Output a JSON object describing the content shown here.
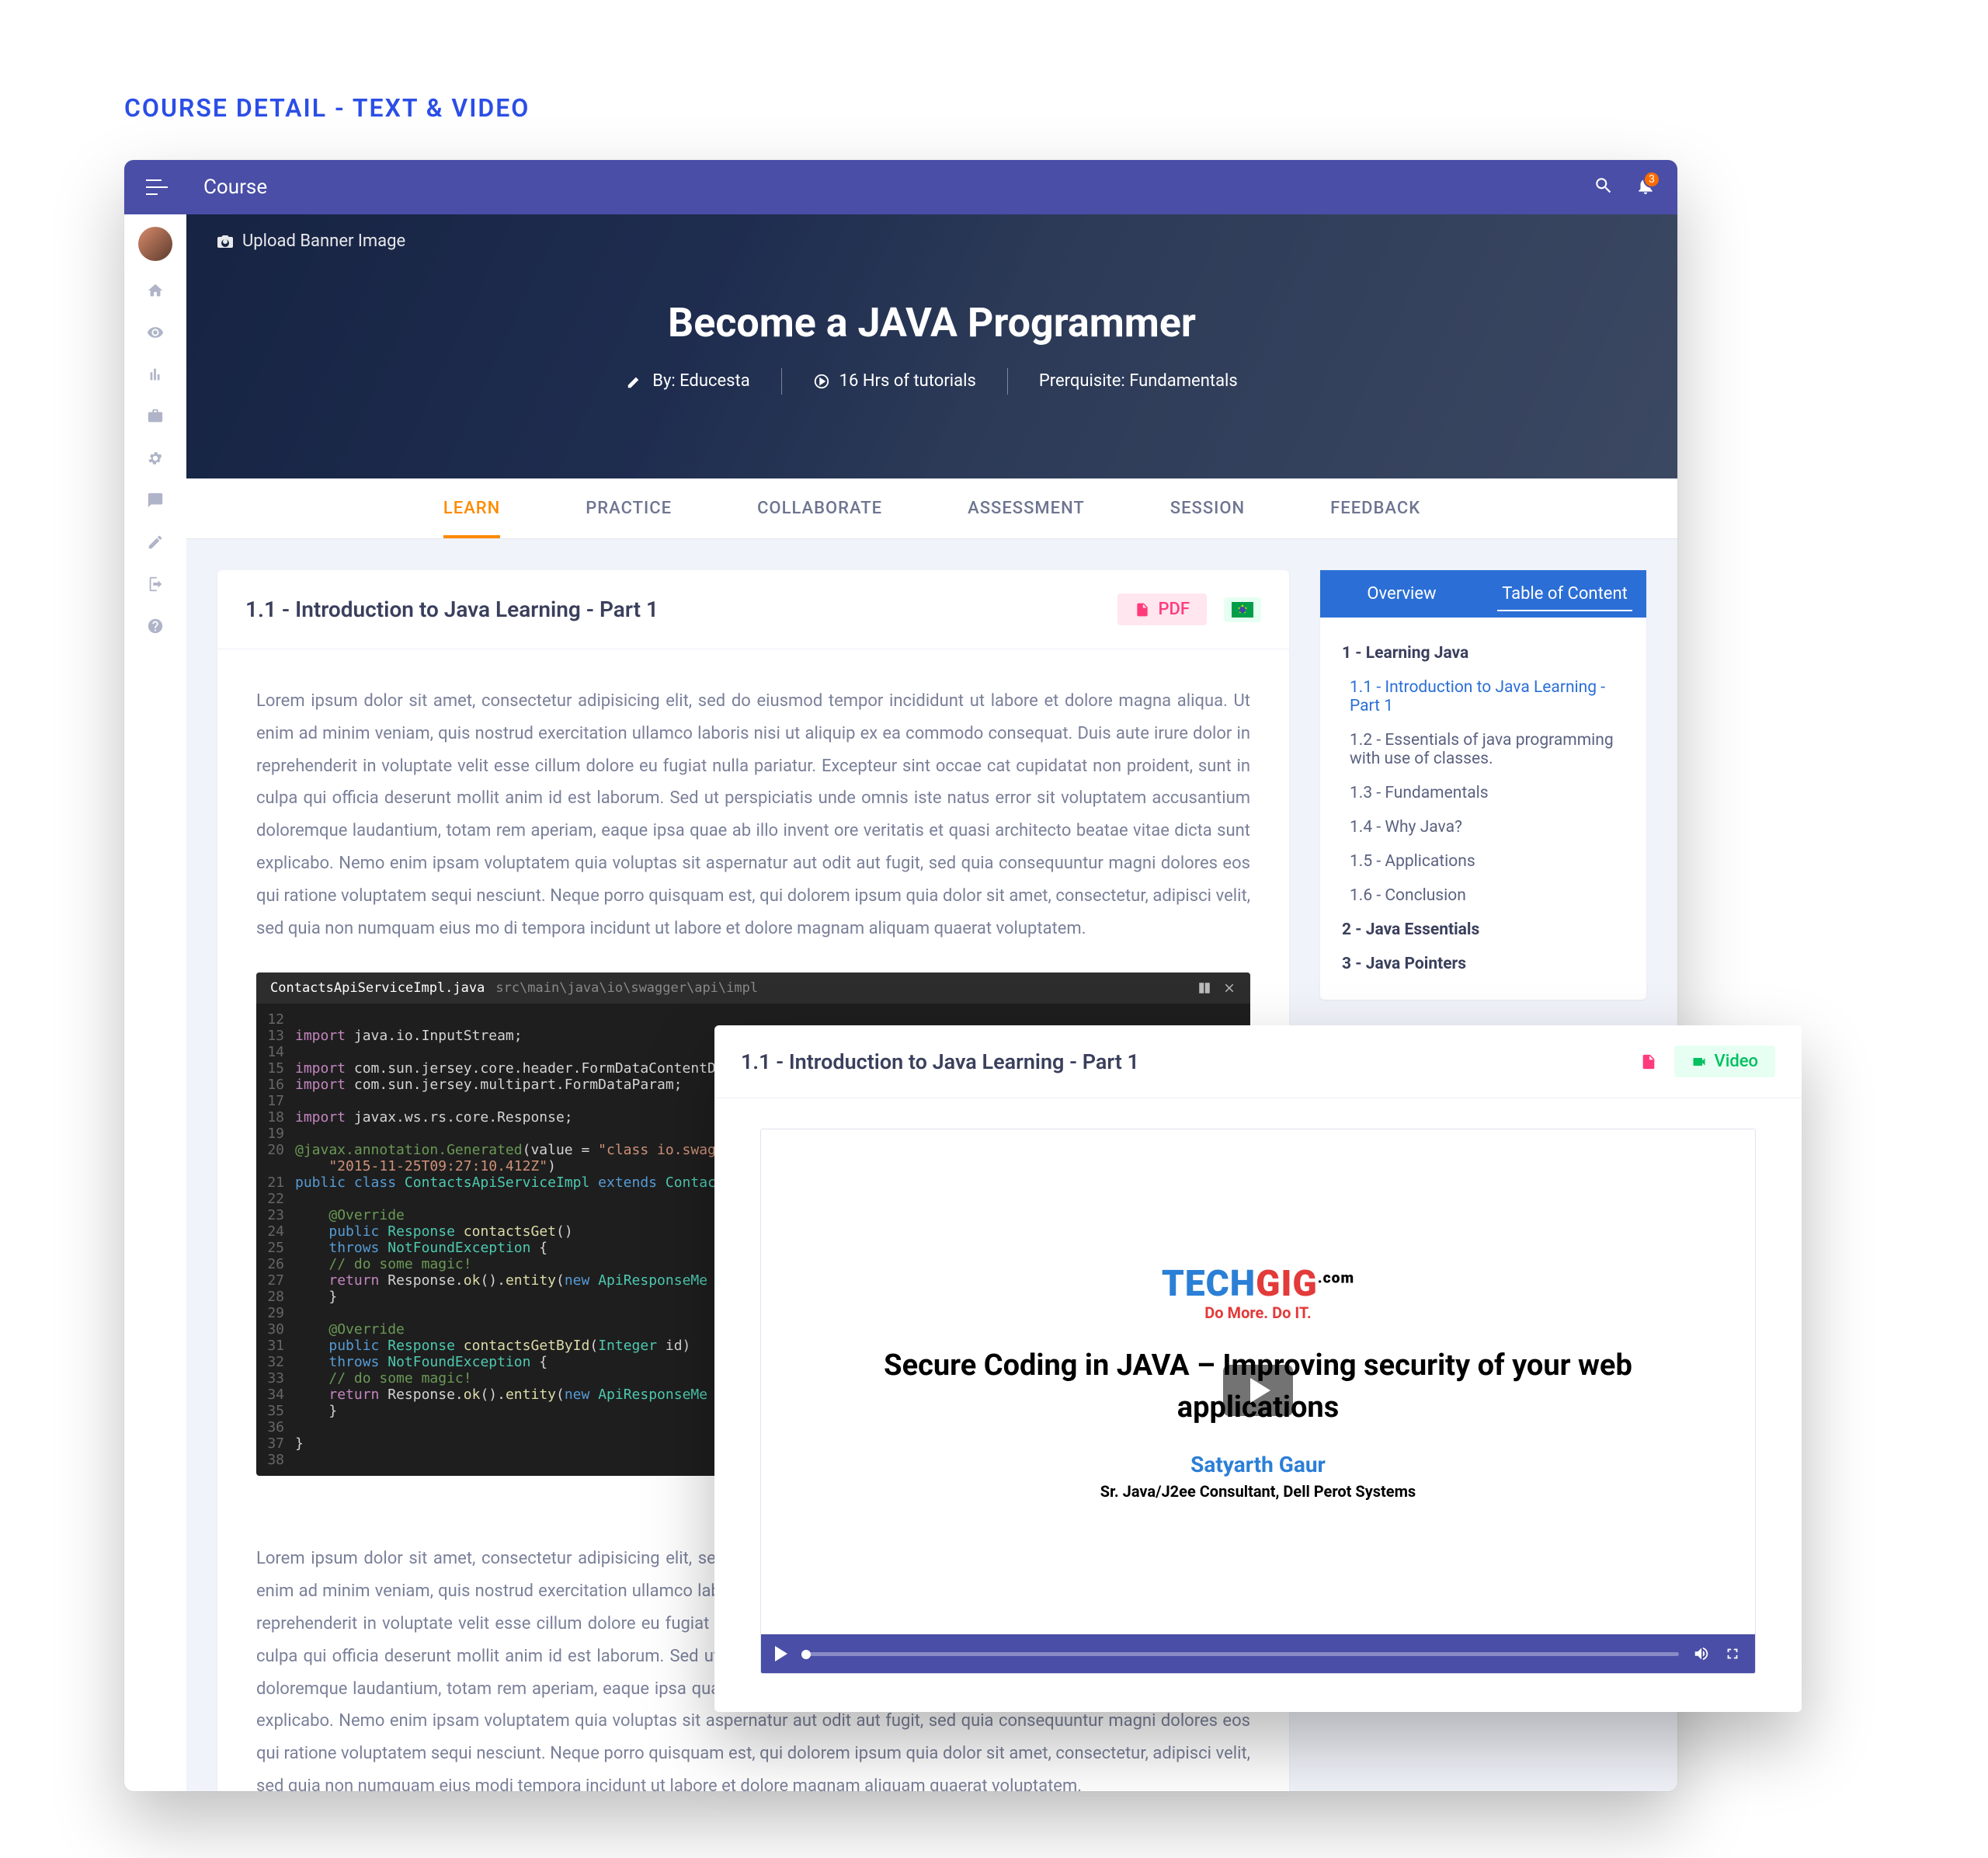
{
  "designTitle": "COURSE DETAIL - TEXT & VIDEO",
  "topbar": {
    "title": "Course",
    "notifications": "3"
  },
  "banner": {
    "upload": "Upload Banner Image",
    "title": "Become a JAVA Programmer",
    "byLabel": "By: Educesta",
    "duration": "16 Hrs of tutorials",
    "prereq": "Prerquisite: Fundamentals"
  },
  "tabs": [
    "LEARN",
    "PRACTICE",
    "COLLABORATE",
    "ASSESSMENT",
    "SESSION",
    "FEEDBACK"
  ],
  "lesson": {
    "title": "1.1 - Introduction to Java Learning - Part 1",
    "pdfLabel": "PDF",
    "para1": "Lorem ipsum dolor sit amet, consectetur adipisicing elit, sed do eiusmod tempor incididunt ut labore et dolore magna aliqua. Ut enim ad minim veniam, quis nostrud exercitation ullamco laboris nisi ut aliquip ex ea commodo consequat. Duis aute irure dolor in reprehenderit in voluptate velit esse cillum dolore eu fugiat nulla pariatur. Excepteur sint occae cat cupidatat non proident, sunt in culpa qui officia deserunt mollit anim id est laborum. Sed ut perspiciatis unde omnis iste natus error sit voluptatem accusantium doloremque laudantium, totam rem aperiam, eaque ipsa quae ab illo invent ore veritatis et quasi architecto beatae vitae dicta sunt explicabo. Nemo enim ipsam voluptatem quia voluptas sit aspernatur aut odit aut fugit, sed quia consequuntur magni dolores eos qui ratione voluptatem sequi nesciunt. Neque porro quisquam est, qui dolorem ipsum quia dolor sit amet, consectetur, adipisci velit, sed quia non numquam eius mo di tempora incidunt ut labore et dolore magnam aliquam quaerat voluptatem.",
    "para2": "Lorem ipsum dolor sit amet, consectetur adipisicing elit, sed do eiusmod tempor incididunt ut labore et dolore magna aliqua. Ut enim ad minim veniam, quis nostrud exercitation ullamco laboris nisi ut aliquip ex ea commodo consequat. Duis aute irure dolor in reprehenderit in voluptate velit esse cillum dolore eu fugiat nulla pariatur. Excepteur sint occaecat cupidatat non proident, sunt in culpa qui officia deserunt mollit anim id est laborum. Sed ut perspiciatis unde omnis iste natus error sit voluptatem accusantium doloremque laudantium, totam rem aperiam, eaque ipsa quae ab illo inventore veritatis et quasi architecto beatae vitae dicta sunt explicabo. Nemo enim ipsam voluptatem quia voluptas sit aspernatur aut odit aut fugit, sed quia consequuntur magni dolores eos qui ratione voluptatem sequi nesciunt. Neque porro quisquam est, qui dolorem ipsum quia dolor sit amet, consectetur, adipisci velit, sed quia non numquam eius modi tempora incidunt ut labore et dolore magnam aliquam quaerat voluptatem."
  },
  "code": {
    "filename": "ContactsApiServiceImpl.java",
    "path": "src\\main\\java\\io\\swagger\\api\\impl"
  },
  "sidepanel": {
    "tabs": {
      "overview": "Overview",
      "toc": "Table of Content"
    },
    "toc": {
      "c1": "1 - Learning Java",
      "i11": "1.1 - Introduction to Java Learning - Part 1",
      "i12": "1.2 - Essentials of java programming with use of classes.",
      "i13": "1.3 - Fundamentals",
      "i14": "1.4 - Why Java?",
      "i15": "1.5 - Applications",
      "i16": "1.6 - Conclusion",
      "c2": "2 - Java Essentials",
      "c3": "3 - Java Pointers"
    }
  },
  "float": {
    "title": "1.1 - Introduction to Java Learning - Part 1",
    "videoLabel": "Video",
    "logoA": "TECH",
    "logoB": "GIG",
    "logoC": ".com",
    "tagline": "Do More. Do IT.",
    "videoTitle": "Secure Coding in JAVA – Improving security of your web applications",
    "author": "Satyarth Gaur",
    "subtitle": "Sr. Java/J2ee Consultant, Dell Perot Systems"
  }
}
